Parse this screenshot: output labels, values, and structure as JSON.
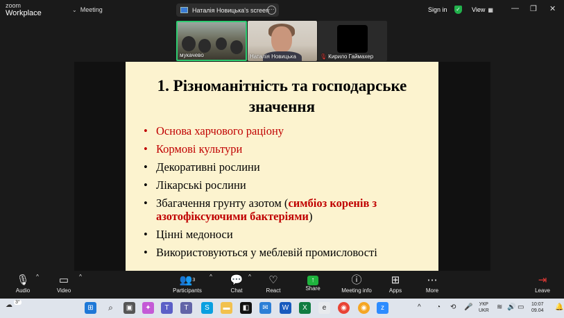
{
  "titlebar": {
    "brand_line1": "zoom",
    "brand_line2": "Workplace",
    "meeting_label": "Meeting",
    "screen_label": "Наталія Новицька's screen",
    "signin": "Sign in",
    "view": "View",
    "accent": "#22b14c"
  },
  "participants": [
    {
      "name": "мукачево",
      "active_speaker": true
    },
    {
      "name": "Наталія Новицька"
    },
    {
      "name": "Кирило Гаймахер",
      "muted": true
    }
  ],
  "slide": {
    "title_line1": "1. Різноманітність та господарське",
    "title_line2": "значення",
    "bullets": [
      {
        "text": "Основа харчового раціону",
        "color": "#c00000"
      },
      {
        "text": "Кормові культури",
        "color": "#c00000"
      },
      {
        "text": "Декоративні рослини"
      },
      {
        "text": "Лікарські рослини"
      },
      {
        "text_before": "Збагачення грунту азотом (",
        "text_highlight_1": "симбіоз коренів з",
        "text_highlight_2": "азотофіксуючими бактеріями",
        "text_after": ")"
      },
      {
        "text": "Цінні медоноси"
      },
      {
        "text": "Використовуються у меблевій промисловості"
      }
    ],
    "background": "#fcf3cf"
  },
  "toolbar": {
    "audio": "Audio",
    "video": "Video",
    "participants": "Participants",
    "participants_count": "3",
    "chat": "Chat",
    "react": "React",
    "share": "Share",
    "meeting_info": "Meeting info",
    "apps": "Apps",
    "more": "More",
    "leave": "Leave"
  },
  "taskbar": {
    "weather_temp": "3°",
    "lang_line1": "УКР",
    "lang_line2": "UKR",
    "time": "10:07",
    "date": "09.04"
  }
}
